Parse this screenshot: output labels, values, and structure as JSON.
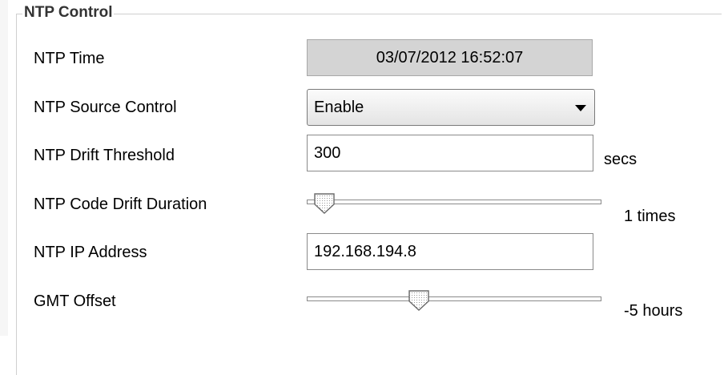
{
  "group": {
    "title": "NTP Control"
  },
  "rows": {
    "ntp_time": {
      "label": "NTP Time",
      "value": "03/07/2012 16:52:07"
    },
    "source_control": {
      "label": "NTP Source Control",
      "value": "Enable"
    },
    "drift_threshold": {
      "label": "NTP Drift Threshold",
      "value": "300",
      "unit": "secs"
    },
    "drift_duration": {
      "label": "NTP Code Drift Duration",
      "unit_text": "1 times",
      "slider_level": 0.06
    },
    "ip_address": {
      "label": "NTP IP Address",
      "value": "192.168.194.8"
    },
    "gmt_offset": {
      "label": "GMT Offset",
      "unit_text": "-5 hours",
      "slider_level": 0.38
    }
  },
  "icons": {
    "dropdown": "chevron-down-icon",
    "slider_thumb": "slider-thumb-icon"
  }
}
